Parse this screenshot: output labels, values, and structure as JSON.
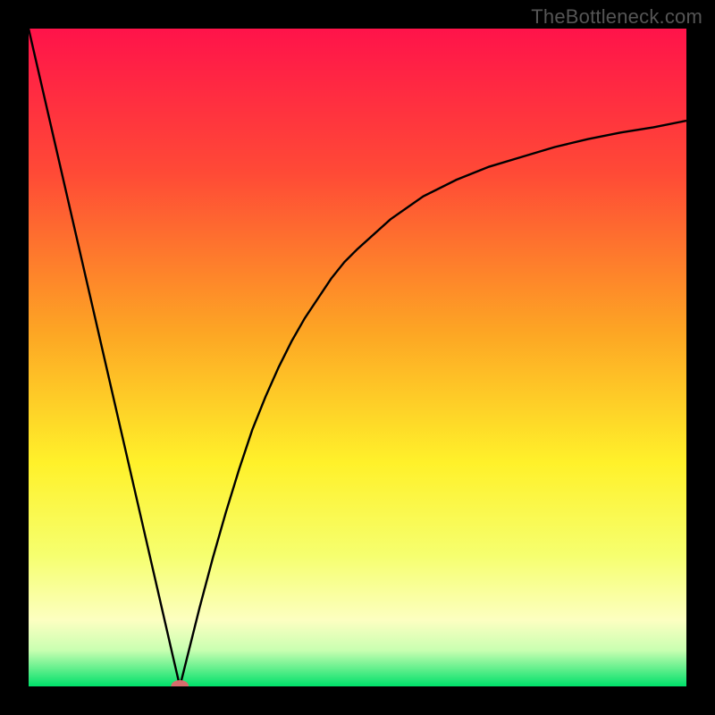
{
  "watermark": "TheBottleneck.com",
  "chart_data": {
    "type": "line",
    "title": "",
    "xlabel": "",
    "ylabel": "",
    "xlim": [
      0,
      100
    ],
    "ylim": [
      0,
      100
    ],
    "x": [
      0,
      2,
      4,
      6,
      8,
      10,
      12,
      14,
      16,
      18,
      20,
      22,
      23,
      24,
      26,
      28,
      30,
      32,
      34,
      36,
      38,
      40,
      42,
      44,
      46,
      48,
      50,
      55,
      60,
      65,
      70,
      75,
      80,
      85,
      90,
      95,
      100
    ],
    "y": [
      100,
      91.3,
      82.6,
      73.9,
      65.2,
      56.5,
      47.8,
      39.1,
      30.4,
      21.7,
      13.0,
      4.3,
      0,
      4.0,
      12.0,
      19.5,
      26.5,
      33.0,
      39.0,
      44.0,
      48.5,
      52.5,
      56.0,
      59.0,
      62.0,
      64.5,
      66.5,
      71.0,
      74.5,
      77.0,
      79.0,
      80.5,
      82.0,
      83.2,
      84.2,
      85.0,
      86.0
    ],
    "marker": {
      "x": 23,
      "y": 0
    },
    "gradient_stops": [
      {
        "offset": 0.0,
        "color": "#ff134a"
      },
      {
        "offset": 0.22,
        "color": "#ff4a36"
      },
      {
        "offset": 0.46,
        "color": "#fda524"
      },
      {
        "offset": 0.66,
        "color": "#fff12a"
      },
      {
        "offset": 0.8,
        "color": "#f6ff6e"
      },
      {
        "offset": 0.9,
        "color": "#fcffc1"
      },
      {
        "offset": 0.945,
        "color": "#c9ffb1"
      },
      {
        "offset": 1.0,
        "color": "#00e06a"
      }
    ],
    "marker_color": "#d76c6c",
    "curve_color": "#000000"
  }
}
